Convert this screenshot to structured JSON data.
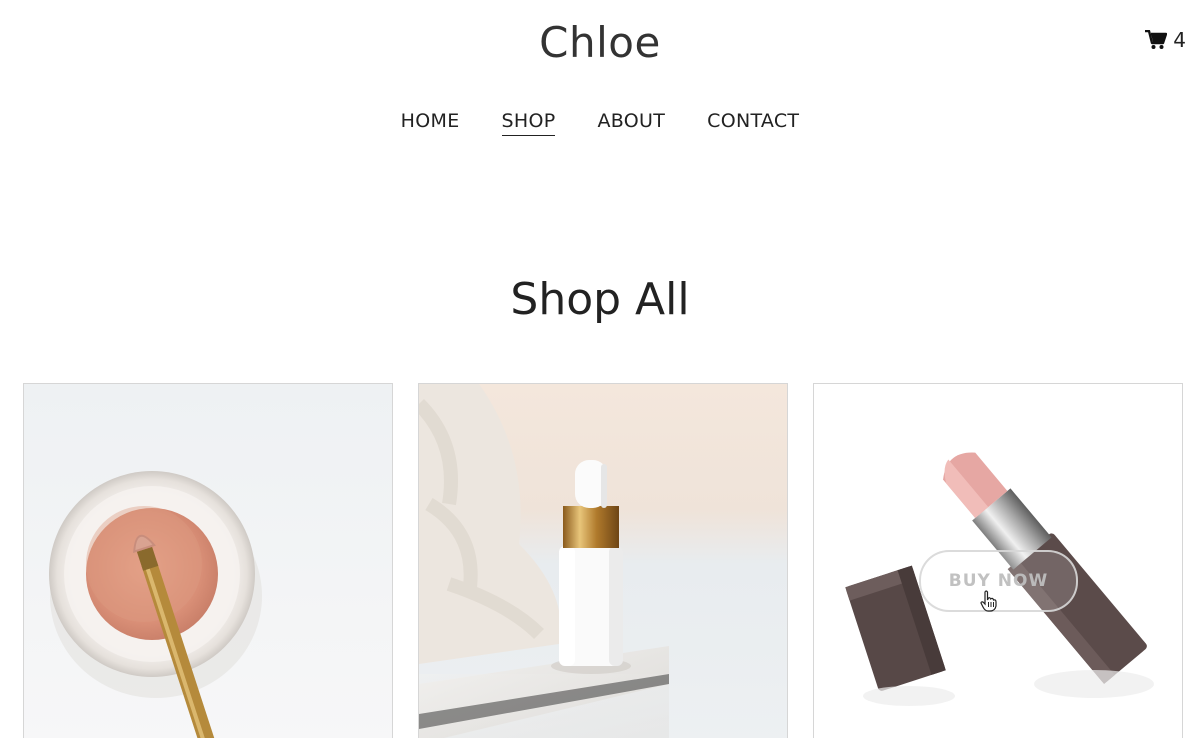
{
  "header": {
    "brand": "Chloe",
    "cart_count": "4"
  },
  "nav": {
    "items": [
      {
        "label": "HOME"
      },
      {
        "label": "SHOP",
        "active": true
      },
      {
        "label": "ABOUT"
      },
      {
        "label": "CONTACT"
      }
    ]
  },
  "main": {
    "title": "Shop All",
    "products": [
      {
        "image": "eyeshadow-powder-jar-with-brush"
      },
      {
        "image": "dropper-serum-bottle"
      },
      {
        "image": "lipstick",
        "hover_label": "BUY NOW"
      }
    ]
  },
  "icons": {
    "cart": "cart-icon",
    "cursor": "hand-pointer-icon"
  },
  "colors": {
    "text": "#222222",
    "card_border": "#d6d6d6",
    "powder": "#d9957d",
    "lipstick": "#e8a6a2",
    "case": "#5a4a49",
    "gold": "#b98a3e"
  }
}
